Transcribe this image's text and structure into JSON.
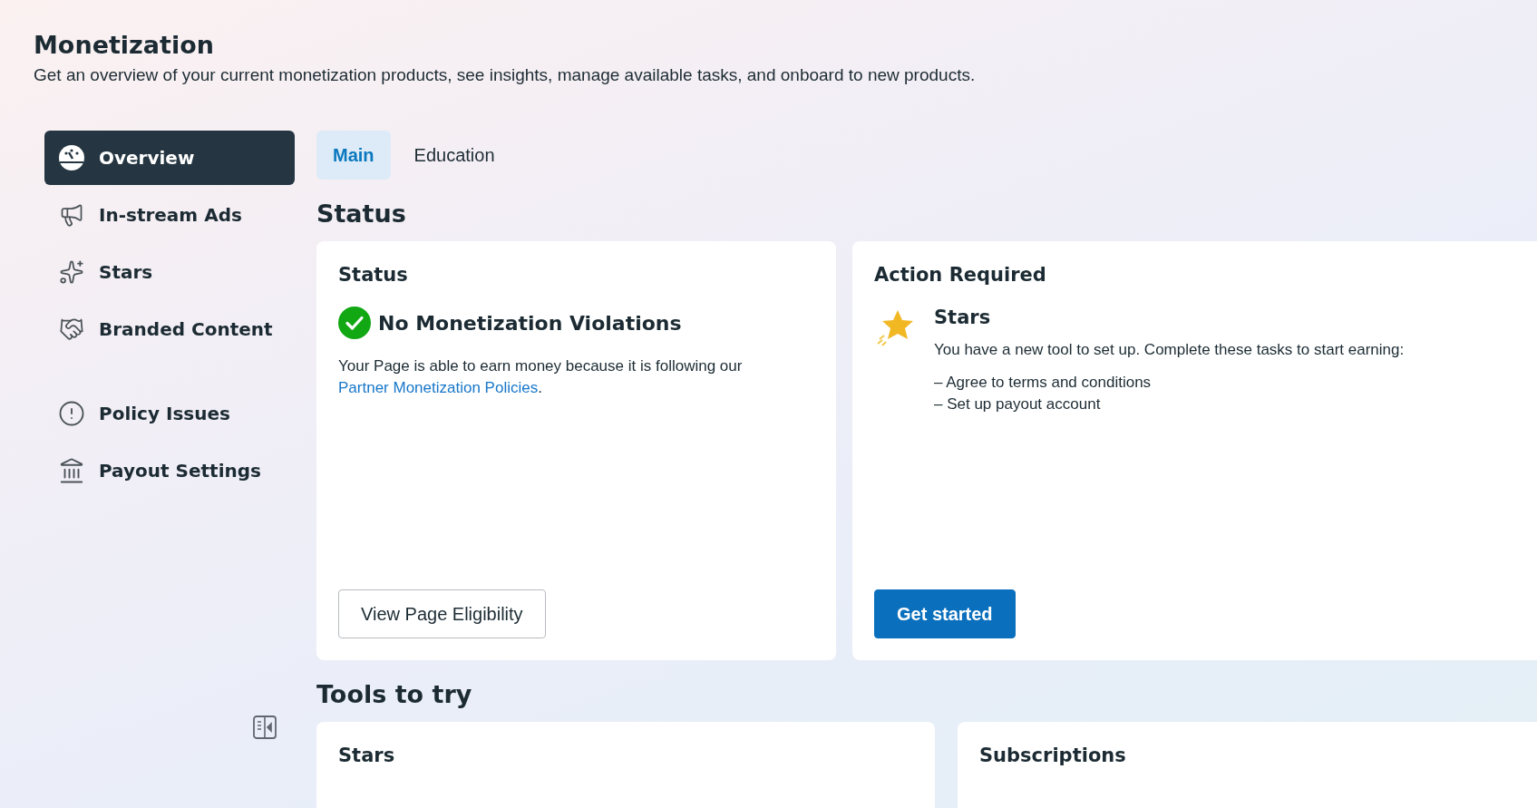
{
  "header": {
    "title": "Monetization",
    "description": "Get an overview of your current monetization products, see insights, manage available tasks, and onboard to new products."
  },
  "sidebar": {
    "sections": [
      {
        "items": [
          {
            "label": "Overview",
            "selected": true
          },
          {
            "label": "In-stream Ads",
            "selected": false
          },
          {
            "label": "Stars",
            "selected": false
          },
          {
            "label": "Branded Content",
            "selected": false
          }
        ]
      },
      {
        "items": [
          {
            "label": "Policy Issues",
            "selected": false
          },
          {
            "label": "Payout Settings",
            "selected": false
          }
        ]
      }
    ]
  },
  "tabs": [
    {
      "label": "Main",
      "selected": true
    },
    {
      "label": "Education",
      "selected": false
    }
  ],
  "status_heading": "Status",
  "status_card": {
    "title": "Status",
    "status": "No Monetization Violations",
    "body": "Your Page is able to earn money because it is following our",
    "link": "Partner Monetization Policies",
    "body_end": ".",
    "button": "View Page Eligibility"
  },
  "action_card": {
    "title": "Action Required",
    "task_title": "Stars",
    "task_description": "You have a new tool to set up. Complete these tasks to start earning:",
    "steps": [
      "– Agree to terms and conditions",
      "– Set up payout account"
    ],
    "button": "Get started"
  },
  "tools_heading": "Tools to try",
  "tools": [
    {
      "title": "Stars"
    },
    {
      "title": "Subscriptions"
    }
  ]
}
